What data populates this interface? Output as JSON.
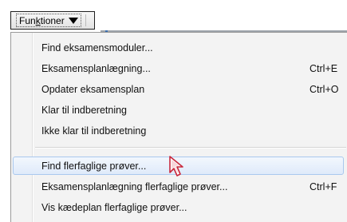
{
  "menu_button": {
    "label": "Funktioner",
    "mnemonic_index": 3
  },
  "menu": {
    "items_group1": [
      {
        "label": "Find eksamensmoduler...",
        "shortcut": ""
      },
      {
        "label": "Eksamensplanlægning...",
        "shortcut": "Ctrl+E"
      },
      {
        "label": "Opdater eksamensplan",
        "shortcut": "Ctrl+O"
      },
      {
        "label": "Klar til indberetning",
        "shortcut": ""
      },
      {
        "label": "Ikke klar til indberetning",
        "shortcut": ""
      }
    ],
    "items_group2": [
      {
        "label": "Find flerfaglige prøver...",
        "shortcut": "",
        "highlighted": true
      },
      {
        "label": "Eksamensplanlægning flerfaglige prøver...",
        "shortcut": "Ctrl+F"
      },
      {
        "label": "Vis kædeplan flerfaglige prøver...",
        "shortcut": ""
      }
    ]
  },
  "colors": {
    "highlight_border": "#a9c8ee",
    "menu_background": "#f3f3f3",
    "cursor_accent": "#c8283c"
  },
  "icons": {
    "dropdown_caret": "caret-down-icon",
    "cursor": "mouse-pointer-icon"
  }
}
